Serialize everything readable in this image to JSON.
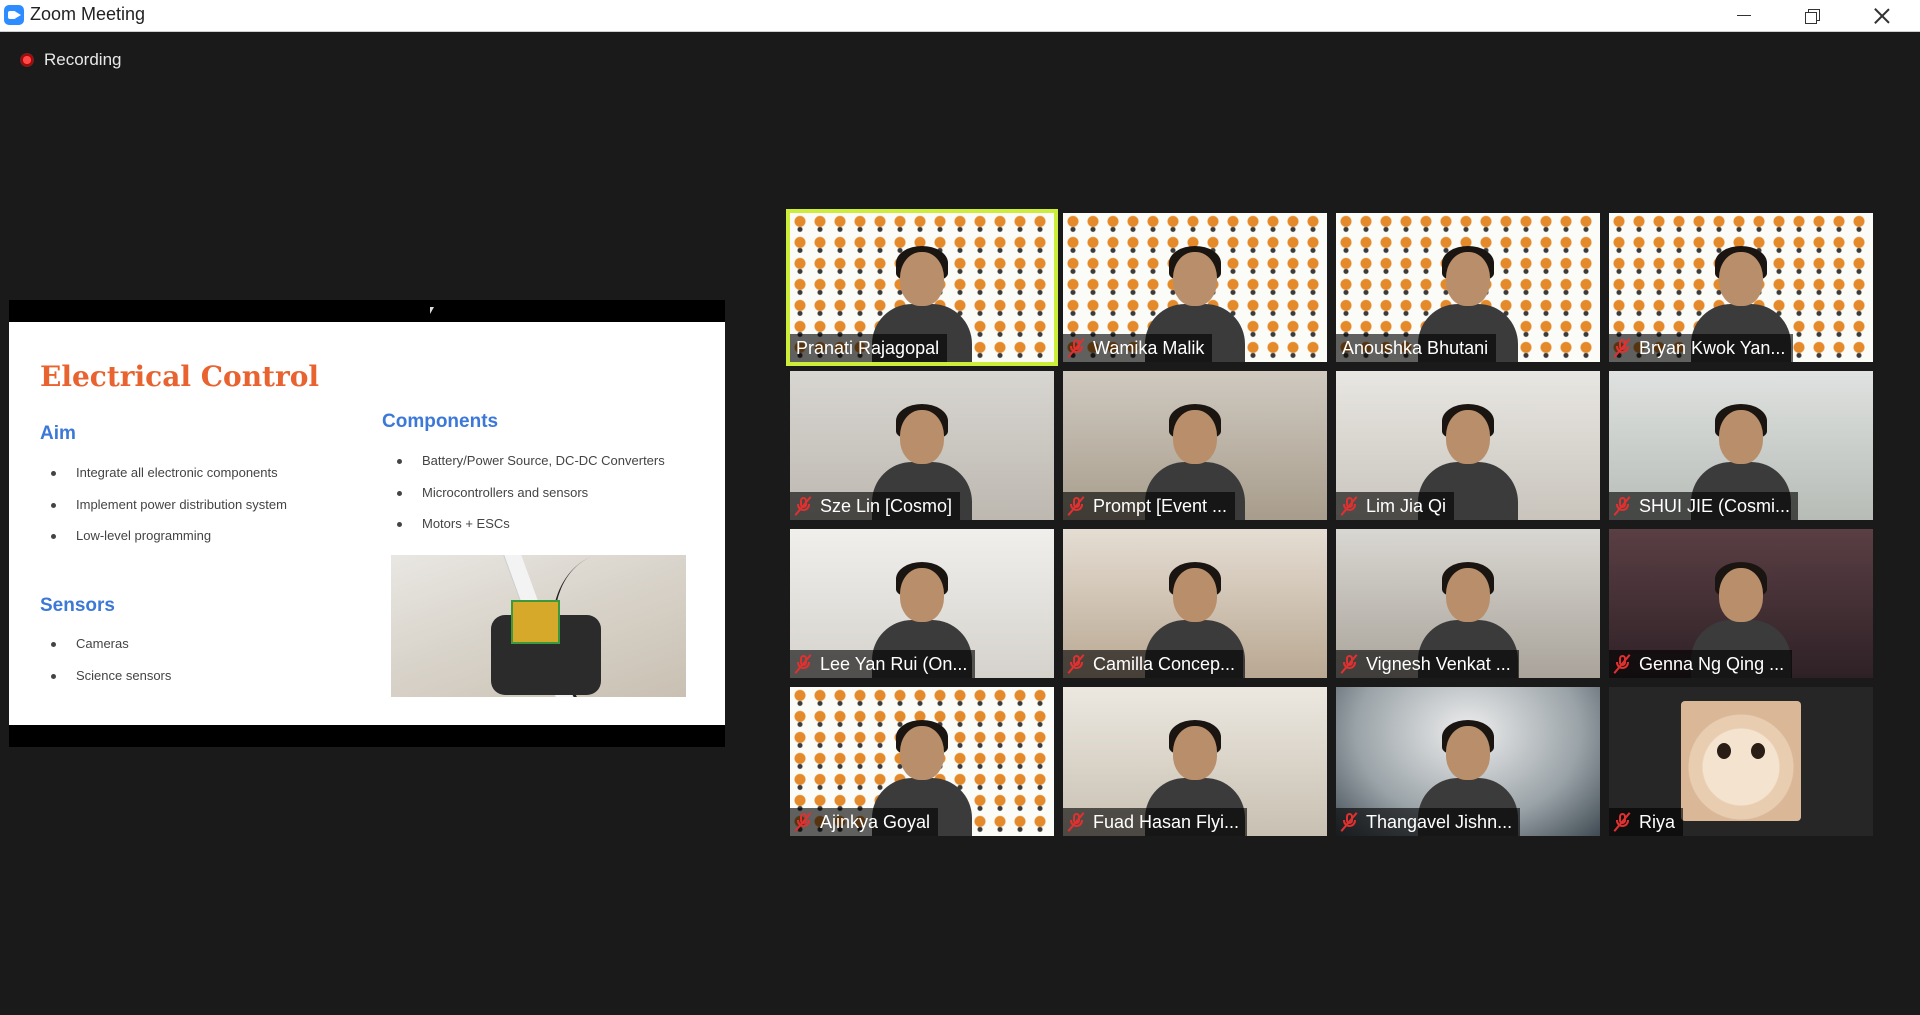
{
  "window": {
    "title": "Zoom Meeting"
  },
  "recording": {
    "label": "Recording"
  },
  "slide": {
    "title": "Electrical Control",
    "aim_heading": "Aim",
    "aim_items": [
      "Integrate all electronic components",
      "Implement power distribution system",
      "Low-level programming"
    ],
    "sensors_heading": "Sensors",
    "sensors_items": [
      "Cameras",
      "Science sensors"
    ],
    "components_heading": "Components",
    "components_items": [
      "Battery/Power Source, DC-DC Converters",
      "Microcontrollers and sensors",
      "Motors + ESCs"
    ]
  },
  "participants": [
    {
      "name": "Pranati Rajagopal",
      "muted": false,
      "active_speaker": true,
      "background": "bulbs"
    },
    {
      "name": "Wamika Malik",
      "muted": true,
      "background": "bulbs"
    },
    {
      "name": "Anoushka Bhutani",
      "muted": false,
      "background": "bulbs"
    },
    {
      "name": "Bryan Kwok Yan...",
      "muted": true,
      "background": "bulbs"
    },
    {
      "name": "Sze Lin [Cosmo]",
      "muted": true,
      "background": "room"
    },
    {
      "name": "Prompt [Event ...",
      "muted": true,
      "background": "room"
    },
    {
      "name": "Lim Jia Qi",
      "muted": true,
      "background": "room"
    },
    {
      "name": "SHUI JIE (Cosmi...",
      "muted": true,
      "background": "room"
    },
    {
      "name": "Lee Yan Rui (On...",
      "muted": true,
      "background": "room"
    },
    {
      "name": "Camilla Concep...",
      "muted": true,
      "background": "room"
    },
    {
      "name": "Vignesh Venkat ...",
      "muted": true,
      "background": "room"
    },
    {
      "name": "Genna Ng Qing ...",
      "muted": true,
      "background": "room"
    },
    {
      "name": "Ajinkya Goyal",
      "muted": true,
      "background": "bulbs"
    },
    {
      "name": "Fuad Hasan Flyi...",
      "muted": true,
      "background": "room"
    },
    {
      "name": "Thangavel Jishn...",
      "muted": true,
      "background": "race-car"
    },
    {
      "name": "Riya",
      "muted": true,
      "background": "avatar-cat"
    }
  ],
  "colors": {
    "active_speaker": "#ccee3a",
    "mute": "#e03030",
    "slide_title": "#e8632f",
    "slide_heading": "#3c78d8"
  }
}
